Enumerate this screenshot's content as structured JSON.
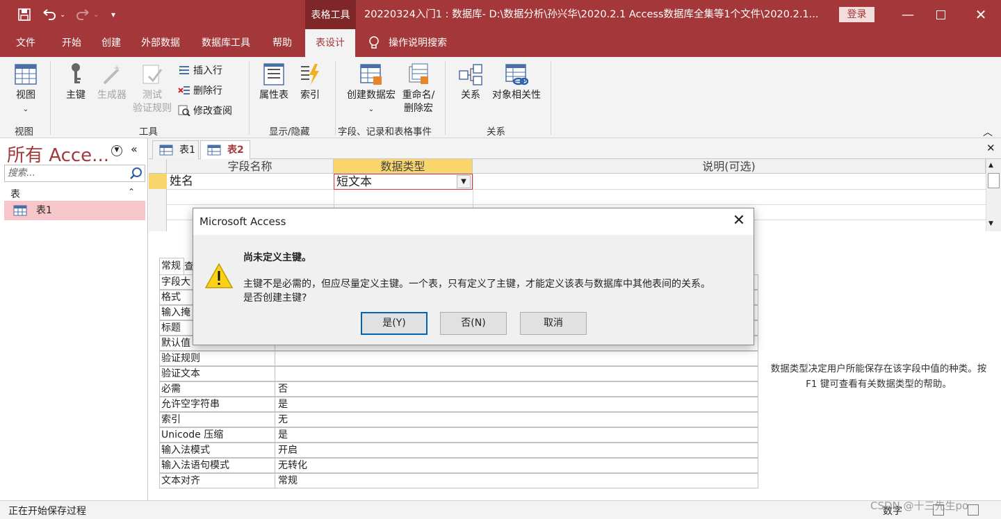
{
  "titlebar": {
    "context_tool": "表格工具",
    "title": "20220324入门1 : 数据库- D:\\数据分析\\孙兴华\\2020.2.1 Access数据库全集等1个文件\\2020.2.1...",
    "login": "登录"
  },
  "tabs": [
    "文件",
    "开始",
    "创建",
    "外部数据",
    "数据库工具",
    "帮助",
    "表设计"
  ],
  "tell_me": "操作说明搜索",
  "ribbon": {
    "view": {
      "btn": "视图",
      "group": "视图"
    },
    "tools": {
      "primary_key": "主键",
      "builder": "生成器",
      "test1": "测试",
      "test2": "验证规则",
      "insert_row": "插入行",
      "delete_row": "删除行",
      "modify_lookup": "修改查阅",
      "group": "工具"
    },
    "showhide": {
      "property_sheet": "属性表",
      "indexes": "索引",
      "group": "显示/隐藏"
    },
    "events": {
      "create_macro": "创建数据宏",
      "rename1": "重命名/",
      "rename2": "删除宏",
      "group": "字段、记录和表格事件"
    },
    "relations": {
      "relationships": "关系",
      "dependencies": "对象相关性",
      "group": "关系"
    }
  },
  "nav": {
    "title": "所有 Acce...",
    "search_placeholder": "搜索...",
    "group": "表",
    "item": "表1"
  },
  "doc_tabs": [
    "表1",
    "表2"
  ],
  "grid": {
    "headers": [
      "字段名称",
      "数据类型",
      "说明(可选)"
    ],
    "row1": {
      "name": "姓名",
      "type": "短文本"
    }
  },
  "props": {
    "tabs": [
      "常规",
      "查"
    ],
    "rows": [
      {
        "k": "字段大",
        "v": ""
      },
      {
        "k": "格式",
        "v": ""
      },
      {
        "k": "输入掩",
        "v": ""
      },
      {
        "k": "标题",
        "v": ""
      },
      {
        "k": "默认值",
        "v": ""
      },
      {
        "k": "验证规则",
        "v": ""
      },
      {
        "k": "验证文本",
        "v": ""
      },
      {
        "k": "必需",
        "v": "否"
      },
      {
        "k": "允许空字符串",
        "v": "是"
      },
      {
        "k": "索引",
        "v": "无"
      },
      {
        "k": "Unicode 压缩",
        "v": "是"
      },
      {
        "k": "输入法模式",
        "v": "开启"
      },
      {
        "k": "输入法语句模式",
        "v": "无转化"
      },
      {
        "k": "文本对齐",
        "v": "常规"
      }
    ],
    "help": "数据类型决定用户所能保存在该字段中值的种类。按 F1 键可查看有关数据类型的帮助。"
  },
  "dialog": {
    "title": "Microsoft Access",
    "heading": "尚未定义主键。",
    "body1": "主键不是必需的，但应尽量定义主键。一个表，只有定义了主键，才能定义该表与数据库中其他表间的关系。",
    "body2": "是否创建主键?",
    "yes": "是(Y)",
    "no": "否(N)",
    "cancel": "取消"
  },
  "status": {
    "left": "正在开始保存过程",
    "num": "数字",
    "watermark": "CSDN @十三先生po"
  }
}
